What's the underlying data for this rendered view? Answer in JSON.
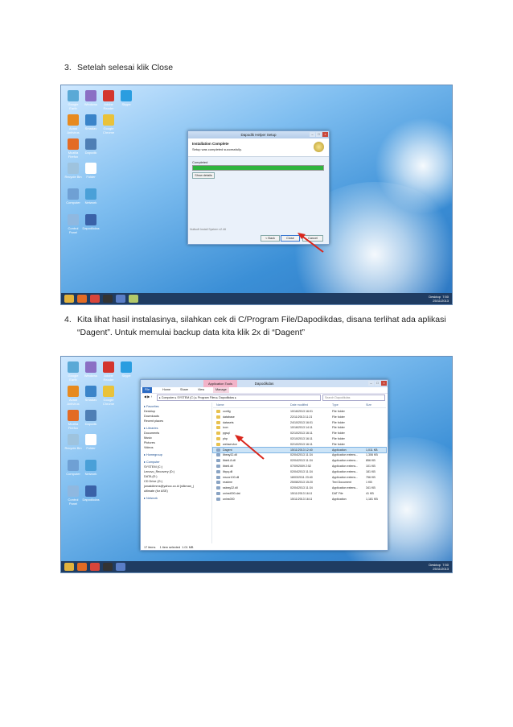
{
  "steps": [
    {
      "number": "3.",
      "text": "Setelah selesai klik Close"
    },
    {
      "number": "4.",
      "text": "Kita lihat hasil instalasinya, silahkan cek di C/Program File/Dapodikdas, disana terlihat ada aplikasi “Dagent”. Untuk memulai backup data kita klik 2x di “Dagent”"
    }
  ],
  "desktop_icons": [
    "Google Earth",
    "Windows",
    "Adobe Reader",
    "Skype",
    "Avast Antivirus",
    "Smadav",
    "Google Chrome",
    "Mozilla Firefox",
    "Dapodik",
    "Recycle Bin",
    "Folder",
    "Computer",
    "Network",
    "Control Panel",
    "Dapodikdas"
  ],
  "setup": {
    "title": "Dapodik Helper Setup",
    "heading": "Installation Complete",
    "subheading": "Setup was completed successfully.",
    "progress_label": "Completed",
    "progress": 1.0,
    "details_button": "Show details",
    "footer": "Nullsoft Install System v2.46",
    "back_button": "< Back",
    "close_button": "Close",
    "cancel_button": "Cancel"
  },
  "explorer": {
    "ribbon_context": "Application Tools",
    "title": "Dapodikdas",
    "menu": [
      "File",
      "Home",
      "Share",
      "View",
      "Manage"
    ],
    "address": "▸ Computer ▸ SYSTEM (C:) ▸ Program Files ▸ Dapodikdas ▸",
    "search_placeholder": "Search Dapodikdas",
    "columns": [
      "Name",
      "Date modified",
      "Type",
      "Size"
    ],
    "nav": [
      "Favorites",
      "Desktop",
      "Downloads",
      "Recent places",
      "Libraries",
      "Documents",
      "Music",
      "Pictures",
      "Videos",
      "Homegroup",
      "Computer",
      "SYSTEM (C:)",
      "Lenovo_Recovery (D:)",
      "DATA (E:)",
      "CD Drive (G:)",
      "jonaddimms@yahoo.co.id (silkman_)",
      "ultimate (for ASE)",
      "Network"
    ],
    "files": [
      {
        "name": "config",
        "date": "10/16/2013 16:01",
        "type": "File folder",
        "size": ""
      },
      {
        "name": "database",
        "date": "22/11/2013 11:21",
        "type": "File folder",
        "size": ""
      },
      {
        "name": "datasets",
        "date": "24/10/2013 16:01",
        "type": "File folder",
        "size": ""
      },
      {
        "name": "icon",
        "date": "10/16/2013 14:11",
        "type": "File folder",
        "size": ""
      },
      {
        "name": "pgsql",
        "date": "02/10/2013 16:11",
        "type": "File folder",
        "size": ""
      },
      {
        "name": "php",
        "date": "02/10/2013 16:11",
        "type": "File folder",
        "size": ""
      },
      {
        "name": "webservice",
        "date": "02/10/2013 16:11",
        "type": "File folder",
        "size": ""
      },
      {
        "name": "Dagent",
        "date": "15/11/2013 12:40",
        "type": "Application",
        "size": "1,011 KB"
      },
      {
        "name": "libeay32.dll",
        "date": "02/04/2013 11:34",
        "type": "Application extens...",
        "size": "1,306 KB"
      },
      {
        "name": "libintl-8.dll",
        "date": "02/04/2013 11:34",
        "type": "Application extens...",
        "size": "856 KB"
      },
      {
        "name": "libintl.dll",
        "date": "07/09/2009 2:52",
        "type": "Application extens...",
        "size": "101 KB"
      },
      {
        "name": "libpq.dll",
        "date": "02/04/2013 11:34",
        "type": "Application extens...",
        "size": "181 KB"
      },
      {
        "name": "msvcr100.dll",
        "date": "18/03/2011 23:40",
        "type": "Application extens...",
        "size": "756 KB"
      },
      {
        "name": "readme",
        "date": "25/08/2013 15:20",
        "type": "Text Document",
        "size": "1 KB"
      },
      {
        "name": "ssleay32.dll",
        "date": "02/04/2013 11:34",
        "type": "Application extens...",
        "size": "341 KB"
      },
      {
        "name": "uninst000.dat",
        "date": "15/11/2013 16:11",
        "type": "DAT File",
        "size": "41 KB"
      },
      {
        "name": "unins000",
        "date": "15/11/2013 16:11",
        "type": "Application",
        "size": "1,181 KB"
      }
    ],
    "status": "17 items     1 item selected  1.01 MB"
  },
  "taskbar": {
    "label": "Desktop",
    "time": "7:50",
    "date": "25/11/2013"
  },
  "colors": {
    "arrow": "#d9261c",
    "progress": "#2fb53e",
    "taskbar": "#1f3c62"
  }
}
